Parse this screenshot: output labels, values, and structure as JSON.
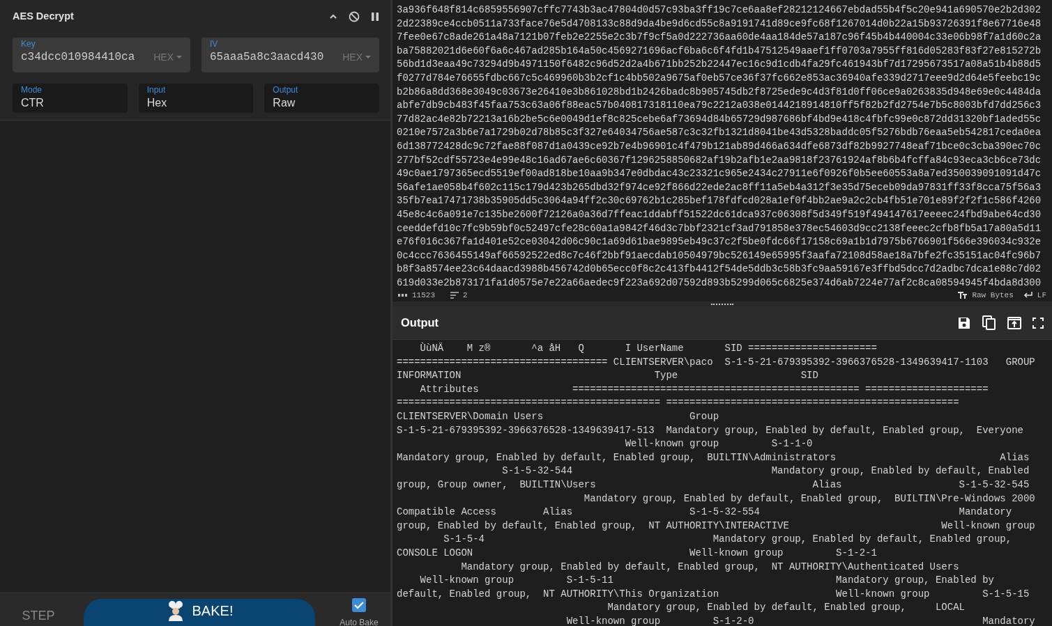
{
  "operation": {
    "title": "AES Decrypt"
  },
  "args": [
    {
      "kind": "toggle",
      "label": "Key",
      "value": "c34dcc010984410ca",
      "format": "HEX"
    },
    {
      "kind": "toggle",
      "label": "IV",
      "value": "65aaa5a8c3aacd430",
      "format": "HEX"
    },
    {
      "kind": "select",
      "label": "Mode",
      "value": "CTR"
    },
    {
      "kind": "select",
      "label": "Input",
      "value": "Hex"
    },
    {
      "kind": "select",
      "label": "Output",
      "value": "Raw"
    }
  ],
  "controls": {
    "step": "STEP",
    "bake": "BAKE!",
    "auto_bake": {
      "label": "Auto Bake",
      "checked": true
    }
  },
  "input": {
    "lines": [
      "3a936f648f814c6859556907cffc7743b3ac47804d0d57c93ba3ff19c7ce6aa8ef28212124667ebdad55b4f5c20e941a690570e2b2d302",
      "2d22389ce4ccb0511a733face76e5d4708133c88d9da4be9d6cd55c8a9191741d89ce9fc68f1267014d0b22a15b93726391f8e67716e48",
      "7fee0e67c8ade261a48a7121b07feb2e2255e2c3b7f9cf5a0d222736aa60de4aa184de57a187c96f45b4b440004c33e06b98f7a1d60c2a",
      "ba75882021d6e60f6a6c467ad285b164a50c4569271696acf6ba6c6f4fd1b47512549aaef1ff0703a7955ff816d05283f83f27e815272b",
      "56bd1d3eaa49c73294d9b4971150f6482c96d52d2a4b671bb252b22447ec16c9d1cdb4fa29fc461943bf7d17295673517a08a51b4b88d5",
      "f0277d784e76655fdbc667c5c469960b3b2cf1c4bb502a9675af0eb57ce36f37fc662e853ac36940afe339d2717eee9d2d64e5feebc19c",
      "b2b86a8dd368e3049c03673e26410e3b861028bd1b2426badc8b905745db2f8725ede9c4d3f81d0ff06ce9a0263835d948e69e0c4484da",
      "abfe7db9cb483f45faa753c63a06f88eac57b040817318110ea79c2212a038e0144218914810ff5f82b2fd2754e7b5c8003bfd7dd256c3",
      "77d82ac4e82b72213a16b2be5c6e0049d1ef8c825cebe6af73694d84b65729d987686bf4bd9e418c4fbfc99e0c872dd31320bf1aded55c",
      "0210e7572a3b6e7a1729b02d78b85c3f327e64034756ae587c3c32fb1321d8041be43d5328baddc05f5276bdb76eaa5eb542817ceda0ea",
      "6d138772428dc9c72fae88f087d1a0439ce92b7e4b96901c4f479b121ab89d466a634dfe6873df82b9927748eaf71bce0c3cba390ec70c",
      "277bf52cdf55723e4e99e48c16ad67ae6c60367f1296258850682af19b2afb1e2aa9818f23761924af8b6b4fcffa84c93eca3cb6ce73dc",
      "49c0ae1797365ecd5519ef00ad818be10aa9b347e0dbdac43c23321c965e2434c27911e6f0926f0b5ee60553a8a7ed350039091091d47c",
      "56afe1ae058b4f602c115c179d423b265dbd32f974ce92f866d22ede2ac8ff11a5eb4a312f3e35d75eceb09da97831ff33f8cca75f56a3",
      "35fb7ea17471738b35905dd5c3064a94ff2c30c69762b1c285bef178fdfcd028a1ef0f4bb2ae9a2c2cb4fb51e701e89f2f2f1c586f4260",
      "45e8c4c6a091e7c135be2600f72126a0a36d7ffeac1ddabff51522dc61dca937c06308f5d349f519f494147617eeeec24fbd9abe64cd30",
      "ceeddefd10c7fc9b59bf0c52497cfe28c60a1a9842f46d3c7bbf2321cf3ad791858e378ec54603d9cc2138feeec2cfb8fb5a17a80a5d11",
      "e76f016c367fa1d401e52ce03042d06c90c1a69d61bae9895eb49c37c2f5be0fdc66f17158c69a1b1d7975b6766901f566e396034c932e",
      "0c4ccc7636455149af66592522ed8c7c46f2bbf91aecdab10504979bc526149e65995f3aafa72108d58ae18a7bfe2fc35151ac04fc96b7",
      "b8f3a8574ee23c64daacd3988b456742d0b65ecc0f8c2c413fb4412f54de5ddb3c58b3fc9aa59167e3ffbd5dcc7d2adbc7dca1e88c7d02",
      "619d033e2b873171fa1d0575e7e22a66aedec9f223a692d07592d893b5299d065c6825e374d6ab7224e77af2c8ca08594945f4bda8d300"
    ],
    "status": {
      "length": "11523",
      "lines": "2",
      "encoding": "Raw Bytes",
      "eol": "LF"
    }
  },
  "output": {
    "title": "Output",
    "lines": [
      "    ÙùNÄ    M z®       ^a åH   Q       I UserName       SID ======================",
      "==================================== CLIENTSERVER\\paco  S-1-5-21-679395392-3966376528-1349639417-1103   GROUP",
      "INFORMATION                                 Type                     SID",
      "    Attributes                ================================================= =====================",
      "============================================= ==================================================",
      "CLIENTSERVER\\Domain Users                         Group",
      "S-1-5-21-679395392-3966376528-1349639417-513  Mandatory group, Enabled by default, Enabled group,  Everyone",
      "                                       Well-known group         S-1-1-0",
      "Mandatory group, Enabled by default, Enabled group,  BUILTIN\\Administrators                            Alias",
      "                  S-1-5-32-544                                  Mandatory group, Enabled by default, Enabled",
      "group, Group owner,  BUILTIN\\Users                                     Alias                    S-1-5-32-545",
      "                                Mandatory group, Enabled by default, Enabled group,  BUILTIN\\Pre-Windows 2000",
      "Compatible Access        Alias                    S-1-5-32-554                                  Mandatory",
      "group, Enabled by default, Enabled group,  NT AUTHORITY\\INTERACTIVE                          Well-known group",
      "        S-1-5-4                                       Mandatory group, Enabled by default, Enabled group,",
      "CONSOLE LOGON                                     Well-known group         S-1-2-1",
      "           Mandatory group, Enabled by default, Enabled group,  NT AUTHORITY\\Authenticated Users",
      "    Well-known group         S-1-5-11                                      Mandatory group, Enabled by",
      "default, Enabled group,  NT AUTHORITY\\This Organization                    Well-known group         S-1-5-15",
      "                                    Mandatory group, Enabled by default, Enabled group,     LOCAL",
      "                             Well-known group         S-1-2-0                                       Mandatory"
    ]
  }
}
